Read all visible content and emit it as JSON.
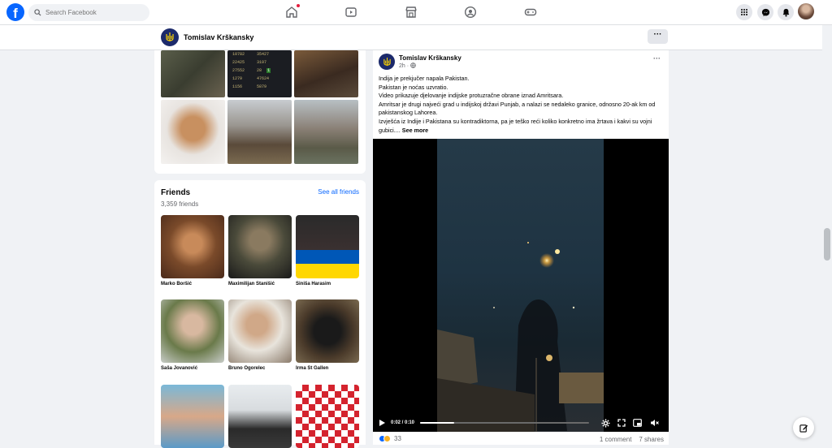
{
  "topbar": {
    "logo": "f",
    "search_placeholder": "Search Facebook",
    "nav_icons": [
      "home-icon",
      "video-icon",
      "marketplace-icon",
      "groups-icon",
      "gaming-icon"
    ],
    "right_icons": [
      "menu-grid-icon",
      "messenger-icon",
      "notifications-icon",
      "profile-avatar"
    ]
  },
  "profile_strip": {
    "name": "Tomislav Krškansky",
    "more_label": "···"
  },
  "photos": {
    "stats_rows": [
      [
        "10782",
        "35427"
      ],
      [
        "22425",
        "3197"
      ],
      [
        "27552",
        "28"
      ],
      [
        "1279",
        "47624"
      ],
      [
        "1156",
        "5879"
      ]
    ],
    "stat_badge": "1"
  },
  "friends": {
    "title": "Friends",
    "count": "3,359 friends",
    "see_all": "See all friends",
    "items": [
      {
        "name": "Marko Boršić"
      },
      {
        "name": "Maximilijan Stanišić"
      },
      {
        "name": "Siniša Harasim"
      },
      {
        "name": "Saša Jovanović"
      },
      {
        "name": "Bruno Ogorelec"
      },
      {
        "name": "Irma St Gallen"
      },
      {
        "name": ""
      },
      {
        "name": ""
      },
      {
        "name": ""
      }
    ]
  },
  "post": {
    "author": "Tomislav Krškansky",
    "time": "2h ·",
    "more": "···",
    "text_lines": [
      "Indija je prekjučer napala Pakistan.",
      "Pakistan je noćas uzvratio.",
      "Video prikazuje djelovanje indijske protuzračne obrane iznad Amritsara.",
      "Amritsar je drugi najveći grad u indijskoj državi Punjab, a nalazi se nedaleko granice, odnosno 20-ak km od pakistanskog Lahorea.",
      "Izvješća iz Indije i Pakistana su kontradiktorna, pa je teško reći koliko konkretno ima žrtava i kakvi su vojni gubici...."
    ],
    "see_more": "See more",
    "video": {
      "time": "0:02 / 0:10",
      "progress": 0.2
    },
    "reaction_count": "33",
    "comments": "1 comment",
    "shares": "7 shares"
  },
  "colors": {
    "brand": "#0866ff",
    "background": "#f0f2f5",
    "notification": "#e41e3f"
  }
}
